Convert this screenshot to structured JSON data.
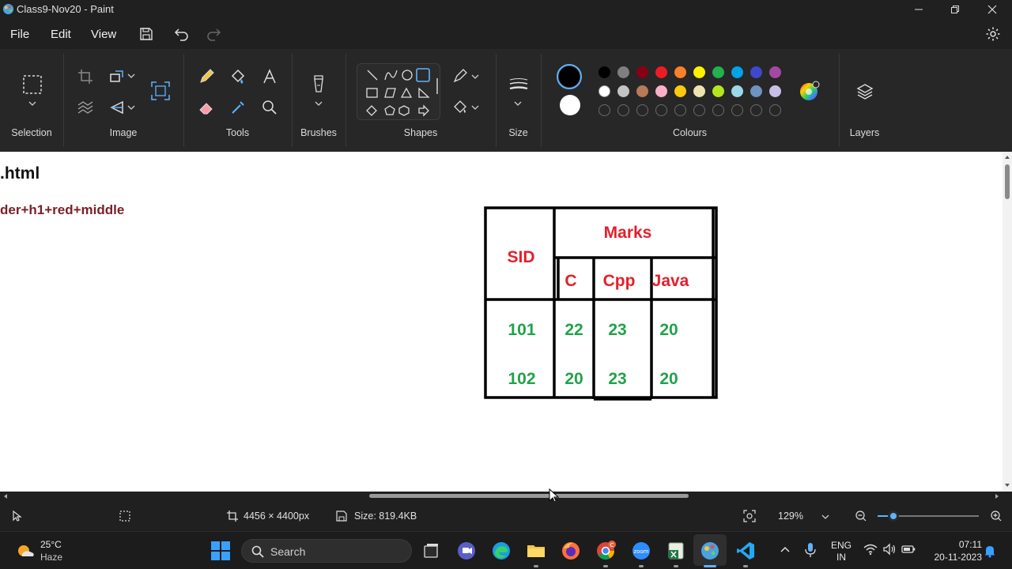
{
  "window": {
    "title": "Class9-Nov20 - Paint"
  },
  "menu": {
    "file": "File",
    "edit": "Edit",
    "view": "View"
  },
  "ribbon": {
    "groups": {
      "selection": "Selection",
      "image": "Image",
      "tools": "Tools",
      "brushes": "Brushes",
      "shapes": "Shapes",
      "size": "Size",
      "colours": "Colours",
      "layers": "Layers"
    },
    "palette_row1": [
      "#000000",
      "#7f7f7f",
      "#880015",
      "#ed1c24",
      "#ff7f27",
      "#fff200",
      "#22b14c",
      "#00a2e8",
      "#3f48cc",
      "#a349a4"
    ],
    "palette_row2": [
      "#ffffff",
      "#c3c3c3",
      "#b97a57",
      "#ffaec9",
      "#ffc90e",
      "#efe4b0",
      "#b5e61d",
      "#99d9ea",
      "#7092be",
      "#c8bfe7"
    ],
    "primary_color": "#000000",
    "secondary_color": "#ffffff"
  },
  "canvas": {
    "title_text": ".html",
    "subtitle_text": "der+h1+red+middle",
    "table": {
      "header_color": "#e2202c",
      "value_color": "#22a24a",
      "sid": "SID",
      "marks": "Marks",
      "subjects": [
        "C",
        "Cpp",
        "Java"
      ],
      "rows": [
        [
          "101",
          "22",
          "23",
          "20"
        ],
        [
          "102",
          "20",
          "23",
          "20"
        ]
      ]
    }
  },
  "status": {
    "dimensions": "4456 × 4400px",
    "size": "Size: 819.4KB",
    "zoom": "129%"
  },
  "taskbar": {
    "weather_temp": "25°C",
    "weather_desc": "Haze",
    "search_placeholder": "Search",
    "lang_line1": "ENG",
    "lang_line2": "IN",
    "time": "07:11",
    "date": "20-11-2023"
  }
}
